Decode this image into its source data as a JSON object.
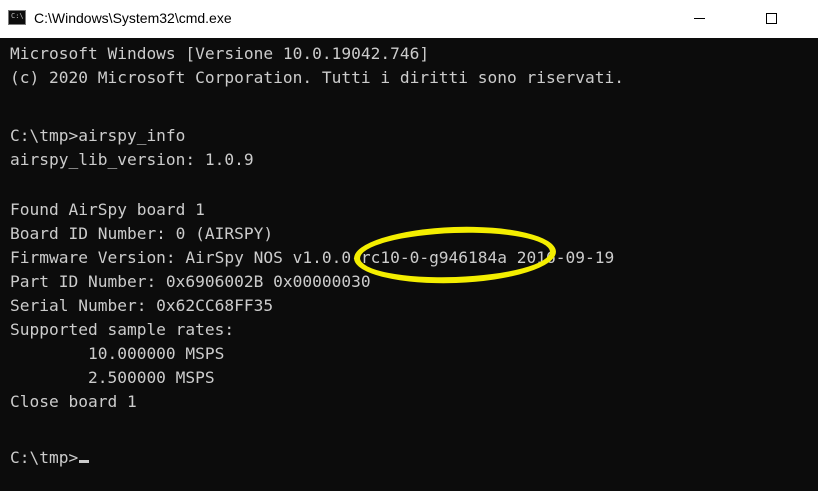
{
  "window": {
    "title": "C:\\Windows\\System32\\cmd.exe",
    "icon_label": "C:\\",
    "minimize_icon": "minimize-icon",
    "maximize_icon": "maximize-icon"
  },
  "console": {
    "lines": [
      "Microsoft Windows [Versione 10.0.19042.746]",
      "(c) 2020 Microsoft Corporation. Tutti i diritti sono riservati.",
      "",
      "C:\\tmp>airspy_info",
      "airspy_lib_version: 1.0.9",
      "",
      "Found AirSpy board 1",
      "Board ID Number: 0 (AIRSPY)",
      "Firmware Version: AirSpy NOS v1.0.0-rc10-0-g946184a 2016-09-19",
      "Part ID Number: 0x6906002B 0x00000030",
      "Serial Number: 0x62CC68FF35",
      "Supported sample rates:",
      "        10.000000 MSPS",
      "        2.500000 MSPS",
      "Close board 1",
      "",
      "C:\\tmp>"
    ]
  },
  "annotation": {
    "color": "#f4ee00",
    "target": "v1.0.0-rc10-0-"
  },
  "colors": {
    "console_bg": "#0c0c0c",
    "console_text": "#cccccc",
    "titlebar_bg": "#ffffff"
  }
}
